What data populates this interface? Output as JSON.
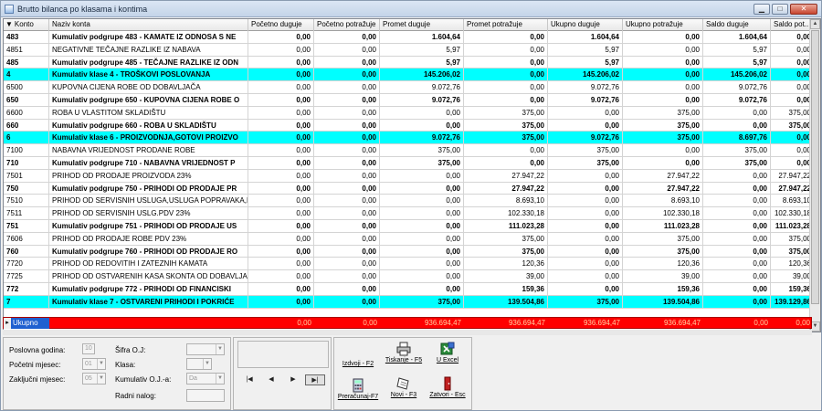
{
  "window": {
    "title": "Brutto bilanca po klasama i kontima",
    "btn_min": "▁",
    "btn_max": "□",
    "btn_close": "✕"
  },
  "columns": [
    "Konto",
    "Naziv konta",
    "Početno duguje",
    "Početno potražuje",
    "Promet duguje",
    "Promet potražuje",
    "Ukupno duguje",
    "Ukupno potražuje",
    "Saldo duguje",
    "Saldo pot..."
  ],
  "rows": [
    {
      "style": "bold",
      "cells": [
        "483",
        "Kumulativ podgrupe 483 - KAMATE IZ ODNOSA S NE",
        "0,00",
        "0,00",
        "1.604,64",
        "0,00",
        "1.604,64",
        "0,00",
        "1.604,64",
        "0,00"
      ]
    },
    {
      "style": "normal",
      "cells": [
        "4851",
        "NEGATIVNE TEČAJNE RAZLIKE IZ NABAVA",
        "0,00",
        "0,00",
        "5,97",
        "0,00",
        "5,97",
        "0,00",
        "5,97",
        "0,00"
      ]
    },
    {
      "style": "bold",
      "cells": [
        "485",
        "Kumulativ podgrupe 485 - TEČAJNE RAZLIKE IZ ODN",
        "0,00",
        "0,00",
        "5,97",
        "0,00",
        "5,97",
        "0,00",
        "5,97",
        "0,00"
      ]
    },
    {
      "style": "cyan",
      "cells": [
        "4",
        "Kumulativ klase 4 - TROŠKOVI POSLOVANJA",
        "0,00",
        "0,00",
        "145.206,02",
        "0,00",
        "145.206,02",
        "0,00",
        "145.206,02",
        "0,00"
      ]
    },
    {
      "style": "normal",
      "cells": [
        "6500",
        "KUPOVNA CIJENA ROBE OD        DOBAVLJAČA",
        "0,00",
        "0,00",
        "9.072,76",
        "0,00",
        "9.072,76",
        "0,00",
        "9.072,76",
        "0,00"
      ]
    },
    {
      "style": "bold",
      "cells": [
        "650",
        "Kumulativ podgrupe 650 - KUPOVNA CIJENA ROBE O",
        "0,00",
        "0,00",
        "9.072,76",
        "0,00",
        "9.072,76",
        "0,00",
        "9.072,76",
        "0,00"
      ]
    },
    {
      "style": "normal",
      "cells": [
        "6600",
        "ROBA U VLASTITOM SKLADIŠTU",
        "0,00",
        "0,00",
        "0,00",
        "375,00",
        "0,00",
        "375,00",
        "0,00",
        "375,00"
      ]
    },
    {
      "style": "bold",
      "cells": [
        "660",
        "Kumulativ podgrupe 660 - ROBA U SKLADIŠTU",
        "0,00",
        "0,00",
        "0,00",
        "375,00",
        "0,00",
        "375,00",
        "0,00",
        "375,00"
      ]
    },
    {
      "style": "cyan",
      "cells": [
        "6",
        "Kumulativ klase 6 - PROIZVODNJA,GOTOVI PROIZVO",
        "0,00",
        "0,00",
        "9.072,76",
        "375,00",
        "9.072,76",
        "375,00",
        "8.697,76",
        "0,00"
      ]
    },
    {
      "style": "normal",
      "cells": [
        "7100",
        "NABAVNA VRIJEDNOST PRODANE    ROBE",
        "0,00",
        "0,00",
        "375,00",
        "0,00",
        "375,00",
        "0,00",
        "375,00",
        "0,00"
      ]
    },
    {
      "style": "bold",
      "cells": [
        "710",
        "Kumulativ podgrupe 710 - NABAVNA VRIJEDNOST P",
        "0,00",
        "0,00",
        "375,00",
        "0,00",
        "375,00",
        "0,00",
        "375,00",
        "0,00"
      ]
    },
    {
      "style": "normal",
      "cells": [
        "7501",
        "PRIHOD OD PRODAJE PROIZVODA 23%",
        "0,00",
        "0,00",
        "0,00",
        "27.947,22",
        "0,00",
        "27.947,22",
        "0,00",
        "27.947,22"
      ]
    },
    {
      "style": "bold",
      "cells": [
        "750",
        "Kumulativ podgrupe 750 - PRIHODI OD PRODAJE PR",
        "0,00",
        "0,00",
        "0,00",
        "27.947,22",
        "0,00",
        "27.947,22",
        "0,00",
        "27.947,22"
      ]
    },
    {
      "style": "normal",
      "cells": [
        "7510",
        "PRIHOD OD SERVISNIH USLUGA,USLUGA POPRAVAKA,PRO",
        "0,00",
        "0,00",
        "0,00",
        "8.693,10",
        "0,00",
        "8.693,10",
        "0,00",
        "8.693,10"
      ]
    },
    {
      "style": "normal",
      "cells": [
        "7511",
        "PRIHOD OD SERVISNIH USLG.PDV 23%",
        "0,00",
        "0,00",
        "0,00",
        "102.330,18",
        "0,00",
        "102.330,18",
        "0,00",
        "102.330,18"
      ]
    },
    {
      "style": "bold",
      "cells": [
        "751",
        "Kumulativ podgrupe 751 - PRIHODI OD PRODAJE US",
        "0,00",
        "0,00",
        "0,00",
        "111.023,28",
        "0,00",
        "111.023,28",
        "0,00",
        "111.023,28"
      ]
    },
    {
      "style": "normal",
      "cells": [
        "7606",
        "PRIHOD OD PRODAJE ROBE PDV 23%",
        "0,00",
        "0,00",
        "0,00",
        "375,00",
        "0,00",
        "375,00",
        "0,00",
        "375,00"
      ]
    },
    {
      "style": "bold",
      "cells": [
        "760",
        "Kumulativ podgrupe 760 - PRIHODI OD PRODAJE RO",
        "0,00",
        "0,00",
        "0,00",
        "375,00",
        "0,00",
        "375,00",
        "0,00",
        "375,00"
      ]
    },
    {
      "style": "normal",
      "cells": [
        "7720",
        "PRIHOD OD REDOVITIH I ZATEZNIH KAMATA",
        "0,00",
        "0,00",
        "0,00",
        "120,36",
        "0,00",
        "120,36",
        "0,00",
        "120,36"
      ]
    },
    {
      "style": "normal",
      "cells": [
        "7725",
        "PRIHOD OD OSTVARENIH KASA SKONTA OD DOBAVLJAČA",
        "0,00",
        "0,00",
        "0,00",
        "39,00",
        "0,00",
        "39,00",
        "0,00",
        "39,00"
      ]
    },
    {
      "style": "bold",
      "cells": [
        "772",
        "Kumulativ podgrupe 772 - PRIHODI OD FINANCISKI",
        "0,00",
        "0,00",
        "0,00",
        "159,36",
        "0,00",
        "159,36",
        "0,00",
        "159,36"
      ]
    },
    {
      "style": "cyan",
      "cells": [
        "7",
        "Kumulativ klase 7 - OSTVARENI PRIHODI I POKRIĆE",
        "0,00",
        "0,00",
        "375,00",
        "139.504,86",
        "375,00",
        "139.504,86",
        "0,00",
        "139.129,86"
      ]
    }
  ],
  "total": {
    "label": "Ukupno",
    "indicator": "▸",
    "values": [
      "0,00",
      "0,00",
      "936.694,47",
      "936.694,47",
      "936.694,47",
      "936.694,47",
      "0,00",
      "0,00"
    ]
  },
  "form": {
    "poslovna_godina_label": "Poslovna godina:",
    "poslovna_godina_value": "10",
    "pocetni_mjesec_label": "Početni mjesec:",
    "pocetni_mjesec_value": "01",
    "zakljucni_mjesec_label": "Zaključni mjesec:",
    "zakljucni_mjesec_value": "05",
    "sifra_oj_label": "Šifra O.J:",
    "sifra_oj_value": "",
    "klasa_label": "Klasa:",
    "klasa_value": "",
    "kumulativ_label": "Kumulativ O.J.-a:",
    "kumulativ_value": "Da",
    "radni_nalog_label": "Radni nalog:",
    "radni_nalog_value": ""
  },
  "nav": {
    "first": "|◀",
    "prev": "◀",
    "next": "▶",
    "last": "▶|"
  },
  "buttons": {
    "izdvoji": "Izdvoji - F2",
    "tiskanje": "Tiskanje - F5",
    "excel": "U Excel",
    "preracunaj": "Preračunaj-F7",
    "novi": "Novi - F3",
    "zatvori": "Zatvori - Esc"
  },
  "sort_glyph": "▼",
  "scroll": {
    "up": "▲",
    "down": "▼"
  },
  "colors": {
    "class_row": "#00ffff",
    "total_row": "#ff0000",
    "selected_label": "#2060d0"
  }
}
